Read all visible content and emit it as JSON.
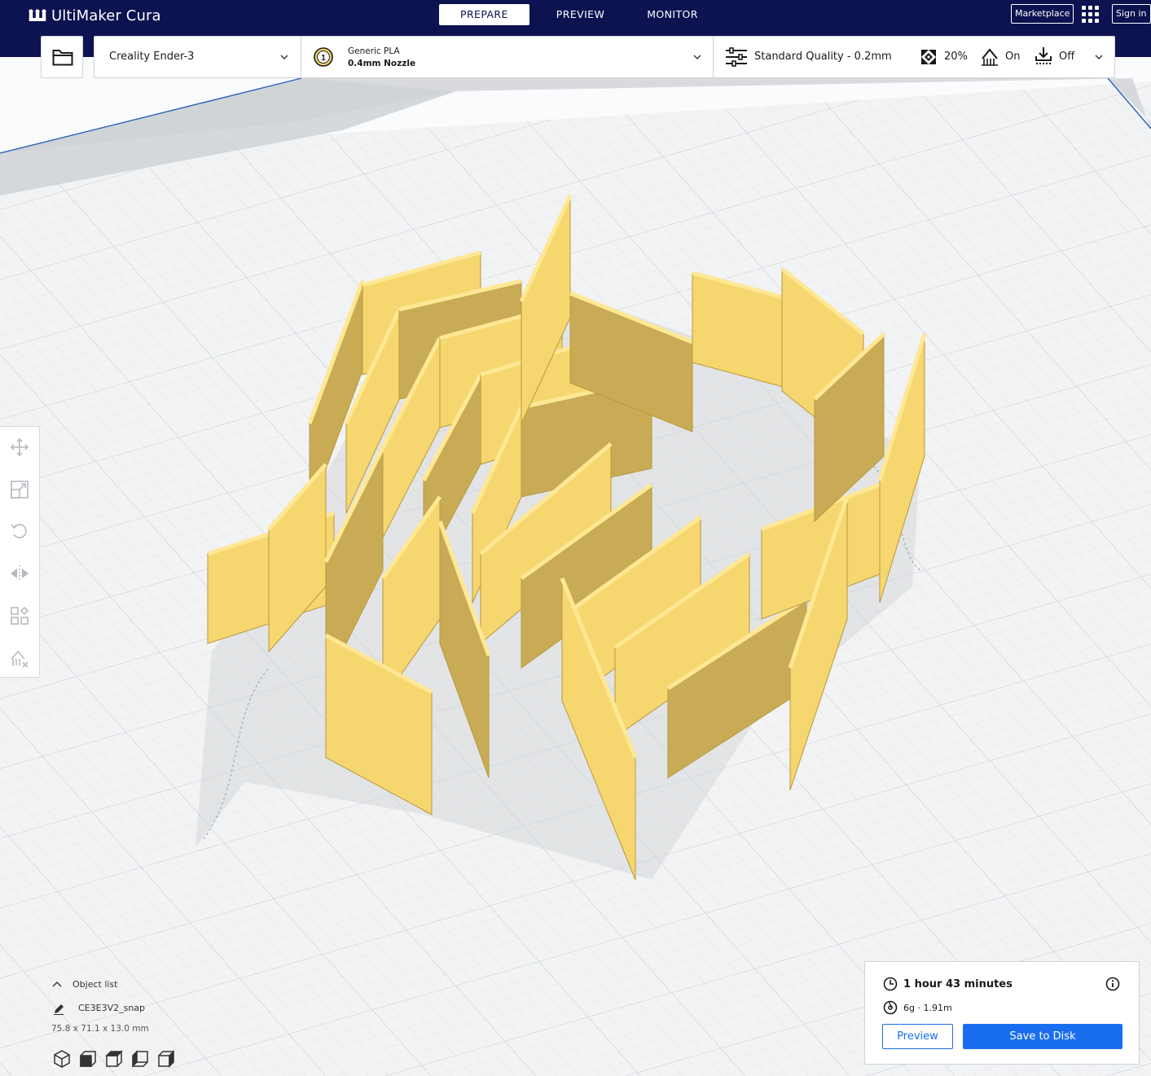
{
  "app": {
    "title": "UltiMaker Cura"
  },
  "nav": {
    "tabs": [
      {
        "label": "PREPARE",
        "active": true
      },
      {
        "label": "PREVIEW",
        "active": false
      },
      {
        "label": "MONITOR",
        "active": false
      }
    ],
    "marketplace_label": "Marketplace",
    "signin_label": "Sign in"
  },
  "printer": {
    "name": "Creality Ender-3"
  },
  "extruder": {
    "number": "1",
    "material": "Generic PLA",
    "nozzle": "0.4mm Nozzle"
  },
  "print_settings": {
    "quality": "Standard Quality - 0.2mm",
    "infill": "20%",
    "support": "On",
    "adhesion": "Off"
  },
  "object_list": {
    "title": "Object list",
    "object_name": "CE3E3V2_snap",
    "dimensions": "75.8 x 71.1 x 13.0 mm"
  },
  "print_info": {
    "time": "1 hour 43 minutes",
    "material": "6g · 1.91m",
    "preview_label": "Preview",
    "save_label": "Save to Disk"
  },
  "colors": {
    "header_bg": "#0d1250",
    "accent": "#196ef0",
    "model_fill": "#f6d66e",
    "model_side": "#c9ab55",
    "buildplate": "#f5f6f7"
  }
}
